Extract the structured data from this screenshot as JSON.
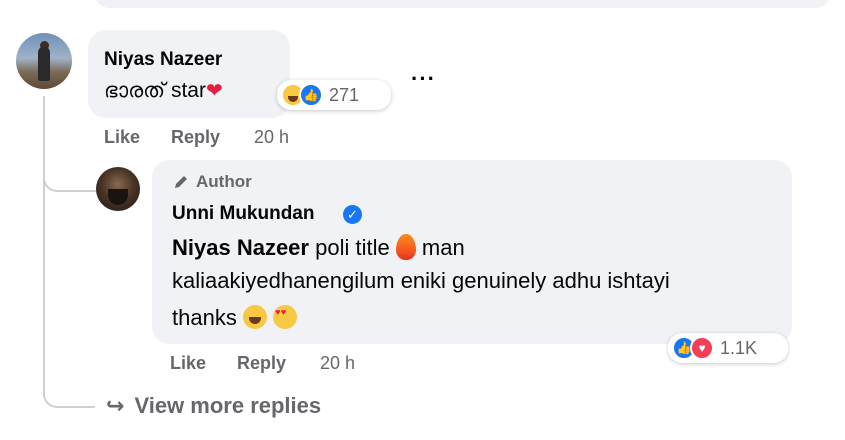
{
  "comment": {
    "author": "Niyas Nazeer",
    "text": "ഭാരത് star",
    "reactions": {
      "icons": [
        "haha-reaction-icon",
        "like-reaction-icon"
      ],
      "count": "271"
    },
    "actions": {
      "like": "Like",
      "reply": "Reply",
      "time": "20 h"
    },
    "more_icon": "···"
  },
  "reply": {
    "badge": "Author",
    "author": "Unni Mukundan",
    "verified_icon": "✓",
    "tag": "Niyas Nazeer",
    "text_part1": " poli title ",
    "text_part2": " man",
    "line2": "kaliaakiyedhanengilum eniki genuinely adhu ishtayi",
    "line3": "thanks ",
    "reactions": {
      "icons": [
        "like-reaction-icon",
        "love-reaction-icon"
      ],
      "count": "1.1K"
    },
    "actions": {
      "like": "Like",
      "reply": "Reply",
      "time": "20 h"
    }
  },
  "view_more": "View more replies",
  "colors": {
    "bubble": "#f0f2f5",
    "muted": "#65676b",
    "text": "#050505",
    "verified": "#1877f2"
  }
}
